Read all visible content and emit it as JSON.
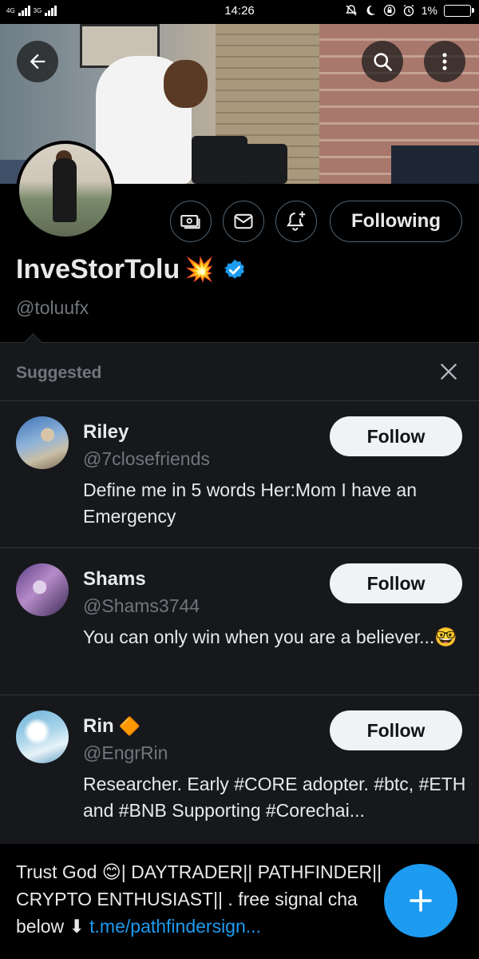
{
  "status_bar": {
    "network_1": "4G",
    "network_2": "3G",
    "time": "14:26",
    "battery": "1%"
  },
  "profile": {
    "display_name": "InveStorTolu",
    "name_emoji": "💥",
    "handle": "@toluufx",
    "following_label": "Following",
    "verified_color": "#1d9bf0"
  },
  "icons": {
    "back": "back-arrow-icon",
    "search": "search-icon",
    "more": "more-vertical-icon",
    "tip": "money-icon",
    "message": "mail-icon",
    "notify": "bell-plus-icon",
    "close": "close-icon",
    "compose": "plus-icon"
  },
  "suggested": {
    "title": "Suggested",
    "users": [
      {
        "name": "Riley",
        "handle": "@7closefriends",
        "bio": "Define me in 5 words Her:Mom I have an Emergency",
        "follow_label": "Follow"
      },
      {
        "name": "Shams",
        "handle": "@Shams3744",
        "bio": "You can only win when you are a believer...🤓",
        "follow_label": "Follow"
      },
      {
        "name": "Rin",
        "name_badge": "🔶",
        "handle": "@EngrRin",
        "bio": "Researcher. Early #CORE adopter. #btc, #ETH and #BNB Supporting #Corechai...",
        "follow_label": "Follow"
      }
    ]
  },
  "bio": {
    "line1": "Trust God 😊| DAYTRADER|| PATHFINDER||",
    "line2": "CRYPTO ENTHUSIAST|| . free signal cha",
    "line3_prefix": "below ⬇",
    "link": "t.me/pathfindersign..."
  },
  "colors": {
    "accent": "#1d9bf0",
    "background": "#000000",
    "card_background": "#16181c",
    "muted_text": "#71767b"
  }
}
